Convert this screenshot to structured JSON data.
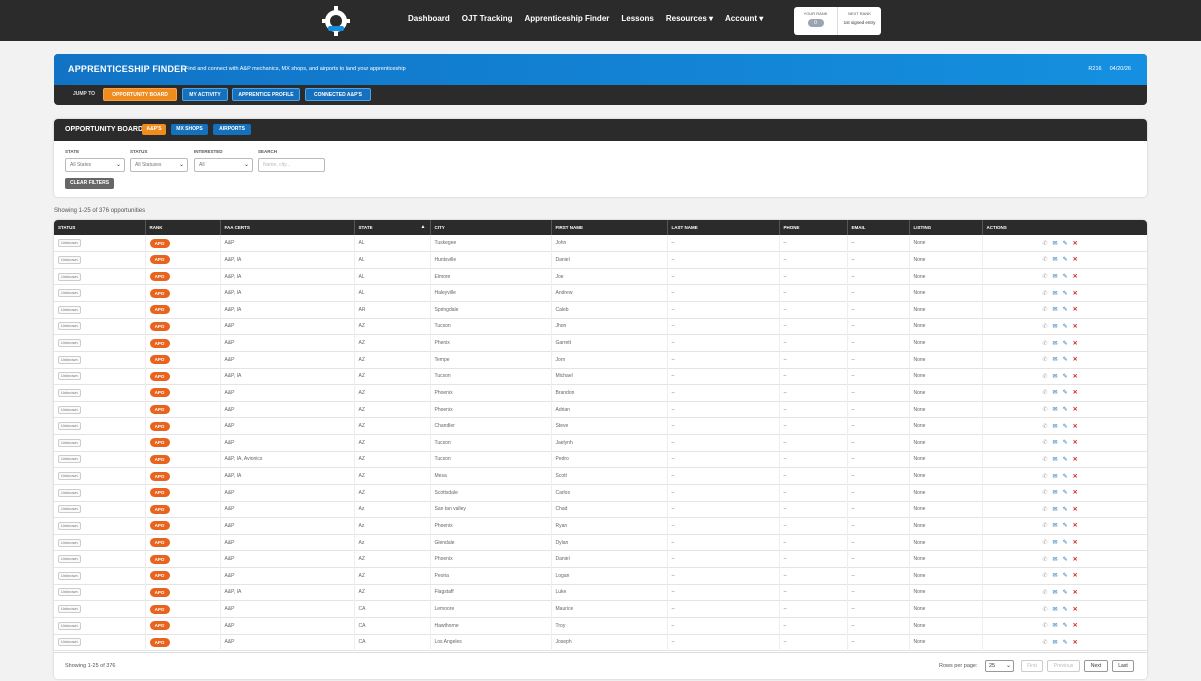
{
  "nav": {
    "links": [
      "Dashboard",
      "OJT Tracking",
      "Apprenticeship Finder",
      "Lessons",
      "Resources ▾",
      "Account ▾"
    ],
    "your_rank_label": "YOUR RANK",
    "your_rank_value": "0",
    "next_rank_label": "NEXT RANK",
    "next_rank_value": "1st signed entry"
  },
  "banner": {
    "title": "APPRENTICESHIP FINDER",
    "subtitle": "Find and connect with A&P mechanics, MX shops, and airports to land your apprenticeship",
    "code": "R216",
    "date": "04/20/26",
    "jump_label": "JUMP TO",
    "jump_buttons": [
      "OPPORTUNITY BOARD",
      "MY ACTIVITY",
      "APPRENTICE PROFILE",
      "CONNECTED A&P'S"
    ]
  },
  "board": {
    "title": "OPPORTUNITY BOARD",
    "tabs": [
      "A&P'S",
      "MX SHOPS",
      "AIRPORTS"
    ],
    "filters": {
      "state_label": "STATE",
      "state_value": "All States",
      "status_label": "STATUS",
      "status_value": "All Statuses",
      "interested_label": "INTERESTED",
      "interested_value": "All",
      "search_label": "SEARCH",
      "search_placeholder": "Name, city..."
    },
    "clear_label": "CLEAR FILTERS"
  },
  "showing_top": "Showing 1-25 of 376 opportunities",
  "table": {
    "headers": [
      "STATUS",
      "RANK",
      "FAA CERTS",
      "STATE",
      "CITY",
      "FIRST NAME",
      "LAST NAME",
      "PHONE",
      "EMAIL",
      "LISTING",
      "ACTIONS"
    ],
    "rows": [
      [
        "Unknown",
        "APO",
        "A&P",
        "AL",
        "Tuskegee",
        "John",
        "–",
        "–",
        "–",
        "None"
      ],
      [
        "Unknown",
        "APO",
        "A&P, IA",
        "AL",
        "Huntsville",
        "Daniel",
        "--",
        "--",
        "--",
        "None"
      ],
      [
        "Unknown",
        "APO",
        "A&P, IA",
        "AL",
        "Elmore",
        "Joe",
        "--",
        "--",
        "--",
        "None"
      ],
      [
        "Unknown",
        "APO",
        "A&P, IA",
        "AL",
        "Haleyville",
        "Andrew",
        "–",
        "–",
        "–",
        "None"
      ],
      [
        "Unknown",
        "APO",
        "A&P, IA",
        "AR",
        "Springdale",
        "Caleb",
        "--",
        "--",
        "--",
        "None"
      ],
      [
        "Unknown",
        "APO",
        "A&P",
        "AZ",
        "Tucson",
        "Jhon",
        "--",
        "--",
        "--",
        "None"
      ],
      [
        "Unknown",
        "APO",
        "A&P",
        "AZ",
        "Phenix",
        "Garrett",
        "--",
        "--",
        "--",
        "None"
      ],
      [
        "Unknown",
        "APO",
        "A&P",
        "AZ",
        "Tempe",
        "Jorn",
        "--",
        "--",
        "--",
        "None"
      ],
      [
        "Unknown",
        "APO",
        "A&P, IA",
        "AZ",
        "Tucson",
        "Michael",
        "–",
        "–",
        "–",
        "None"
      ],
      [
        "Unknown",
        "APO",
        "A&P",
        "AZ",
        "Phoenix",
        "Brandon",
        "--",
        "--",
        "--",
        "None"
      ],
      [
        "Unknown",
        "APO",
        "A&P",
        "AZ",
        "Phoenix",
        "Adrian",
        "--",
        "--",
        "--",
        "None"
      ],
      [
        "Unknown",
        "APO",
        "A&P",
        "AZ",
        "Chandler",
        "Steve",
        "--",
        "--",
        "--",
        "None"
      ],
      [
        "Unknown",
        "APO",
        "A&P",
        "AZ",
        "Tucson",
        "Jaelynh",
        "–",
        "–",
        "–",
        "None"
      ],
      [
        "Unknown",
        "APO",
        "A&P, IA, Avionics",
        "AZ",
        "Tucson",
        "Pedro",
        "--",
        "--",
        "--",
        "None"
      ],
      [
        "Unknown",
        "APO",
        "A&P, IA",
        "AZ",
        "Mesa",
        "Scott",
        "–",
        "–",
        "–",
        "None"
      ],
      [
        "Unknown",
        "APO",
        "A&P",
        "AZ",
        "Scottsdale",
        "Carlos",
        "–",
        "–",
        "–",
        "None"
      ],
      [
        "Unknown",
        "APO",
        "A&P",
        "Az",
        "San tan valley",
        "Chad",
        "--",
        "--",
        "--",
        "None"
      ],
      [
        "Unknown",
        "APO",
        "A&P",
        "Az",
        "Phoenix",
        "Ryan",
        "--",
        "--",
        "--",
        "None"
      ],
      [
        "Unknown",
        "APO",
        "A&P",
        "Az",
        "Glendale",
        "Dylan",
        "–",
        "–",
        "–",
        "None"
      ],
      [
        "Unknown",
        "APO",
        "A&P",
        "AZ",
        "Phoenix",
        "Daniel",
        "--",
        "--",
        "--",
        "None"
      ],
      [
        "Unknown",
        "APO",
        "A&P",
        "AZ",
        "Peoria",
        "Logan",
        "--",
        "--",
        "--",
        "None"
      ],
      [
        "Unknown",
        "APO",
        "A&P, IA",
        "AZ",
        "Flagstaff",
        "Luke",
        "--",
        "--",
        "--",
        "None"
      ],
      [
        "Unknown",
        "APO",
        "A&P",
        "CA",
        "Lemoore",
        "Maurice",
        "--",
        "--",
        "--",
        "None"
      ],
      [
        "Unknown",
        "APO",
        "A&P",
        "CA",
        "Hawthorne",
        "Troy",
        "–",
        "–",
        "–",
        "None"
      ],
      [
        "Unknown",
        "APO",
        "A&P",
        "CA",
        "Los Angeles",
        "Joseph",
        "--",
        "--",
        "--",
        "None"
      ]
    ]
  },
  "footer": {
    "showing": "Showing 1-25 of 376",
    "rows_per_page_label": "Rows per page:",
    "rows_per_page_value": "25",
    "first": "First",
    "previous": "Previous",
    "next": "Next",
    "last": "Last"
  },
  "colors": {
    "accent_orange": "#f08c1e",
    "accent_blue": "#1570bd",
    "rank_orange": "#e8641e",
    "dark": "#2b2b2b"
  }
}
